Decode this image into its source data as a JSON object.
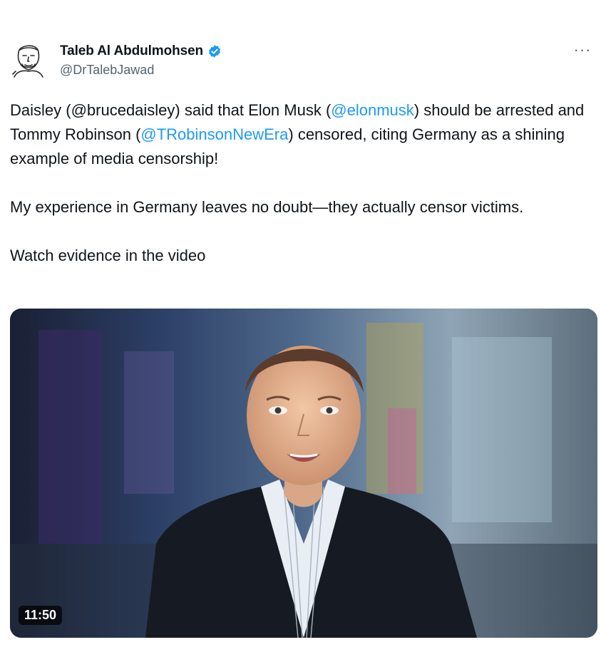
{
  "author": {
    "display_name": "Taleb Al Abdulmohsen",
    "handle": "@DrTalebJawad",
    "verified": true,
    "avatar_icon": "sketch-portrait-avatar"
  },
  "actions": {
    "more_label": "···"
  },
  "tweet": {
    "p1": [
      {
        "text": "Daisley (@brucedaisley) said that Elon Musk ("
      },
      {
        "text": "@elonmusk",
        "mention": true
      },
      {
        "text": ") should be arrested and Tommy Robinson ("
      },
      {
        "text": "@TRobinsonNewEra",
        "mention": true
      },
      {
        "text": ") censored, citing Germany as a shining example of media censorship!"
      }
    ],
    "p2": "My experience in Germany leaves no doubt—they actually censor victims.",
    "p3": "Watch evidence in the video"
  },
  "media": {
    "type": "video",
    "duration": "11:50"
  },
  "colors": {
    "accent": "#1d9bf0",
    "secondary_text": "#536471",
    "primary_text": "#0f1419"
  }
}
